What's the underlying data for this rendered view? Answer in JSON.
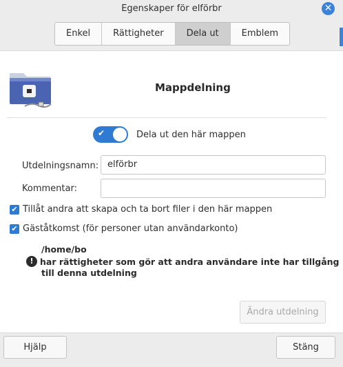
{
  "window": {
    "title": "Egenskaper för elförbr"
  },
  "tabs": [
    {
      "label": "Enkel"
    },
    {
      "label": "Rättigheter"
    },
    {
      "label": "Dela ut",
      "active": true
    },
    {
      "label": "Emblem"
    }
  ],
  "sharing": {
    "heading": "Mappdelning",
    "toggle_label": "Dela ut den här mappen",
    "toggle_on": true,
    "share_name_label": "Utdelningsnamn:",
    "share_name_value": "elförbr",
    "comment_label": "Kommentar:",
    "comment_value": "",
    "allow_others_label": "Tillåt andra att skapa och ta bort filer i den här mappen",
    "allow_others_checked": true,
    "guest_access_label": "Gäståtkomst (för personer utan användarkonto)",
    "guest_access_checked": true,
    "warning_path": "/home/bo",
    "warning_line1": " har rättigheter som gör att andra användare inte har tillgång",
    "warning_line2": "till denna utdelning",
    "modify_button": "Ändra utdelning"
  },
  "footer": {
    "help_button": "Hjälp",
    "close_button": "Stäng"
  },
  "colors": {
    "accent": "#2f7ad3",
    "close_button": "#3b82d9"
  }
}
